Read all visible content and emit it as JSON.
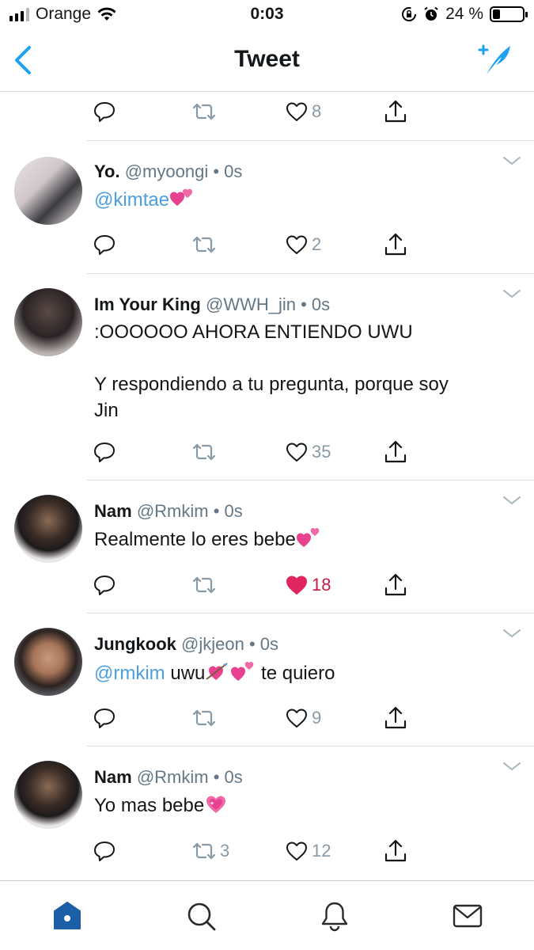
{
  "status_bar": {
    "carrier": "Orange",
    "time": "0:03",
    "battery": "24 %",
    "battery_level": 0.24
  },
  "nav": {
    "title": "Tweet",
    "back_icon": "chevron-left-icon",
    "compose_icon": "compose-tweet-icon"
  },
  "top_actions": {
    "like_count": "8"
  },
  "tweets": [
    {
      "name": "Yo.",
      "handle": "@myoongi",
      "time": "• 0s",
      "mention": "@kimtae",
      "text": "",
      "reply_count": "",
      "retweet_count": "",
      "like_count": "2",
      "liked": false
    },
    {
      "name": "Im Your King",
      "handle": "@WWH_jin",
      "time": "• 0s",
      "text_lines": [
        ":OOOOOO AHORA ENTIENDO UWU",
        "",
        "Y respondiendo a tu pregunta, porque soy",
        "Jin"
      ],
      "like_count": "35",
      "liked": false
    },
    {
      "name": "Nam",
      "handle": "@Rmkim",
      "time": "• 0s",
      "text": "Realmente lo eres bebe",
      "like_count": "18",
      "liked": true
    },
    {
      "name": "Jungkook",
      "handle": "@jkjeon",
      "time": "• 0s",
      "mention": "@rmkim",
      "text": " uwu",
      "text_after": " te quiero",
      "like_count": "9",
      "liked": false
    },
    {
      "name": "Nam",
      "handle": "@Rmkim",
      "time": "• 0s",
      "text": "Yo mas bebe",
      "retweet_count": "3",
      "like_count": "12",
      "liked": false
    }
  ],
  "tab_bar": {
    "items": [
      "home-icon",
      "search-icon",
      "notifications-icon",
      "messages-icon"
    ],
    "active": "home-icon"
  },
  "colors": {
    "accent": "#1da1f2",
    "mention": "#4a9fe0",
    "liked": "#c91a44",
    "meta": "#657786",
    "icon": "#8899a6"
  }
}
